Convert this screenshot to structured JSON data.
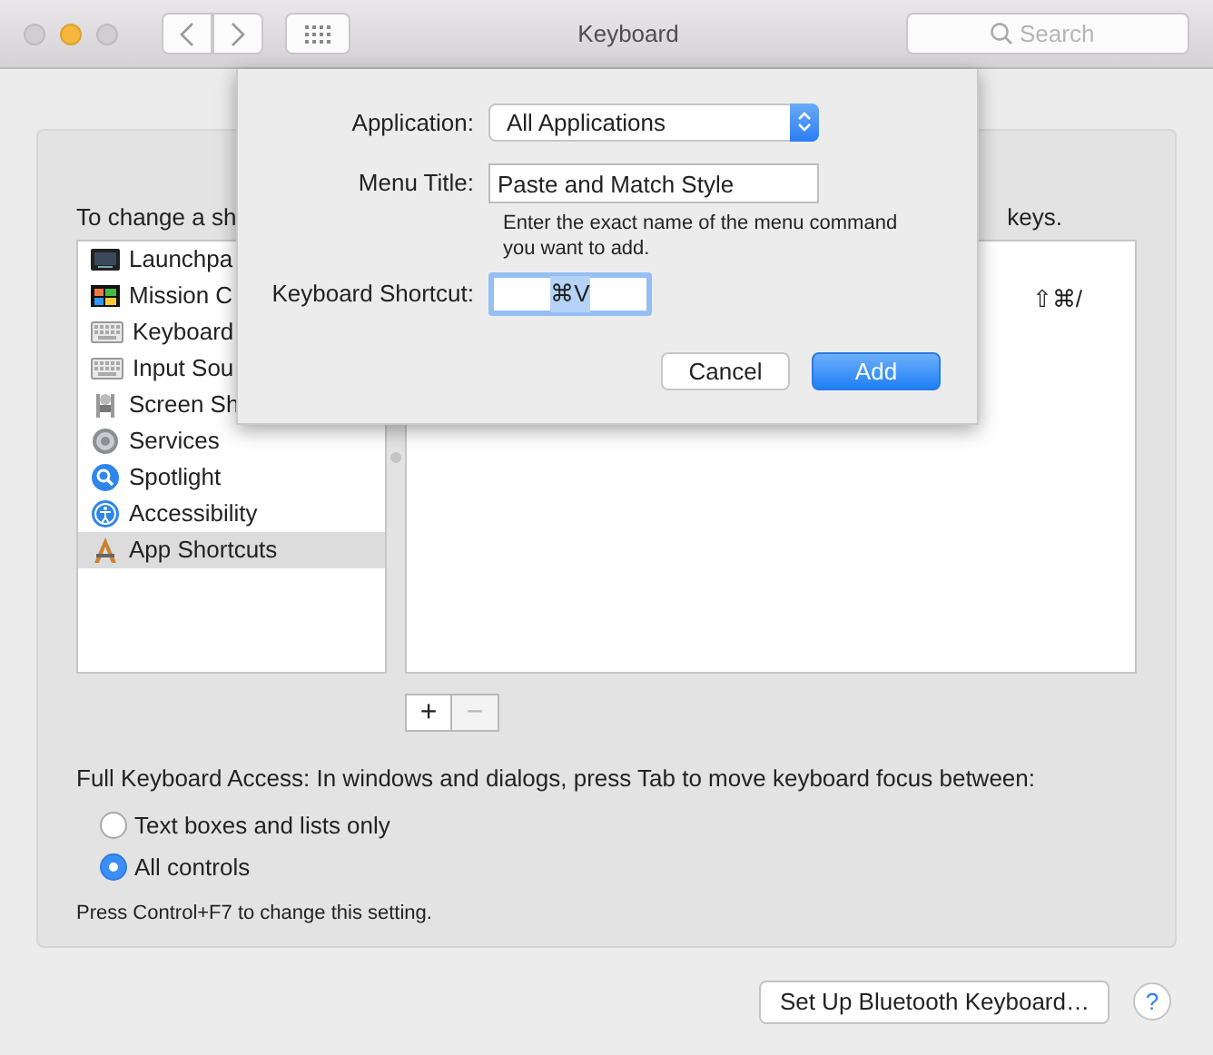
{
  "window": {
    "title": "Keyboard",
    "search": {
      "placeholder": "Search"
    }
  },
  "instruction": {
    "start": "To change a sh",
    "end": "keys."
  },
  "sidebar": {
    "items": [
      {
        "label": "Launchpa",
        "kind": "launchpad",
        "selected": false
      },
      {
        "label": "Mission C",
        "kind": "mission",
        "selected": false
      },
      {
        "label": "Keyboard",
        "kind": "keyboard",
        "selected": false
      },
      {
        "label": "Input Sou",
        "kind": "keyboard",
        "selected": false
      },
      {
        "label": "Screen Sh",
        "kind": "screenshot",
        "selected": false
      },
      {
        "label": "Services",
        "kind": "gear",
        "selected": false
      },
      {
        "label": "Spotlight",
        "kind": "spotlight",
        "selected": false
      },
      {
        "label": "Accessibility",
        "kind": "accessibility",
        "selected": false
      },
      {
        "label": "App Shortcuts",
        "kind": "appshortcuts",
        "selected": true
      }
    ]
  },
  "shortcuts": [
    {
      "keys": "⇧⌘/"
    }
  ],
  "list_buttons": [
    {
      "label": "+",
      "disabled": false
    },
    {
      "label": "−",
      "disabled": true
    }
  ],
  "full_keyboard_access": {
    "label": "Full Keyboard Access: In windows and dialogs, press Tab to move keyboard focus between:",
    "options": [
      {
        "label": "Text boxes and lists only",
        "selected": false
      },
      {
        "label": "All controls",
        "selected": true
      }
    ],
    "hint": "Press Control+F7 to change this setting."
  },
  "bluetooth_button": "Set Up Bluetooth Keyboard…",
  "help_button": "?",
  "dialog": {
    "application_label": "Application:",
    "application_value": "All Applications",
    "menu_title_label": "Menu Title:",
    "menu_title_value": "Paste and Match Style",
    "menu_title_hint": "Enter the exact name of the menu command you want to add.",
    "shortcut_label": "Keyboard Shortcut:",
    "shortcut_value": "⌘V",
    "cancel": "Cancel",
    "add": "Add"
  }
}
